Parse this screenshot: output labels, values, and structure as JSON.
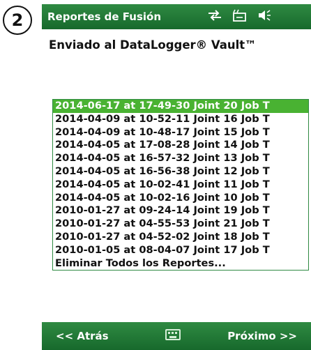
{
  "step_badge": "2",
  "titlebar": {
    "title": "Reportes de Fusión",
    "icons": [
      "signal-arrows-icon",
      "battery-icon",
      "speaker-icon"
    ]
  },
  "subtitle": "Enviado al DataLogger® Vault™",
  "reports": [
    "2014-06-17 at 17-49-30 Joint 20 Job T",
    "2014-04-09 at 10-52-11 Joint 16 Job T",
    "2014-04-09 at 10-48-17 Joint 15 Job T",
    "2014-04-05 at 17-08-28 Joint 14 Job T",
    "2014-04-05 at 16-57-32 Joint 13 Job T",
    "2014-04-05 at 16-56-38 Joint 12 Job T",
    "2014-04-05 at 10-02-41 Joint 11 Job T",
    "2014-04-05 at 10-02-16 Joint 10 Job T",
    "2010-01-27 at 09-24-14 Joint 19 Job T",
    "2010-01-27 at 04-55-53 Joint 21 Job T",
    "2010-01-27 at 04-52-02 Joint 18 Job T",
    "2010-01-05 at 08-04-07 Joint 17 Job T",
    "Eliminar Todos los Reportes..."
  ],
  "selected_index": 0,
  "bottombar": {
    "back_label": "<< Atrás",
    "next_label": "Próximo >>",
    "keyboard_icon": "keyboard-icon"
  },
  "colors": {
    "bar_green": "#17692c",
    "selection_green": "#49b232"
  }
}
